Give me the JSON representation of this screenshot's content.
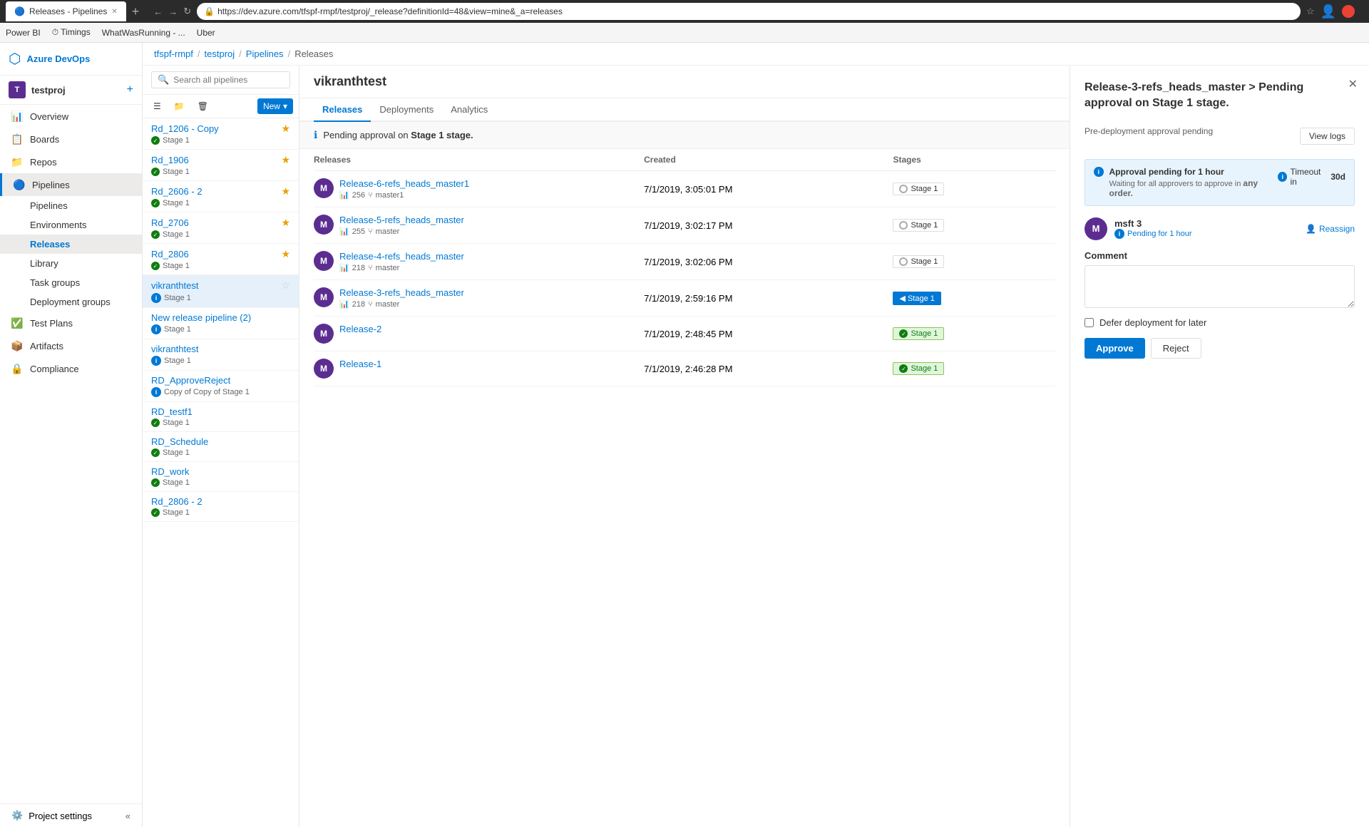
{
  "browser": {
    "tab_title": "Releases - Pipelines",
    "url": "https://dev.azure.com/tfspf-rmpf/testproj/_release?definitionId=48&view=mine&_a=releases",
    "bookmarks": [
      {
        "label": "Power BI"
      },
      {
        "label": "Timings"
      },
      {
        "label": "WhatWasRunning - ..."
      },
      {
        "label": "Uber"
      }
    ]
  },
  "sidebar": {
    "logo_label": "Azure DevOps",
    "project_name": "testproj",
    "project_initials": "T",
    "nav_items": [
      {
        "id": "overview",
        "label": "Overview",
        "icon": "📊"
      },
      {
        "id": "boards",
        "label": "Boards",
        "icon": "📋"
      },
      {
        "id": "repos",
        "label": "Repos",
        "icon": "📁"
      },
      {
        "id": "pipelines",
        "label": "Pipelines",
        "icon": "🔵"
      },
      {
        "id": "test-plans",
        "label": "Test Plans",
        "icon": "✅"
      },
      {
        "id": "artifacts",
        "label": "Artifacts",
        "icon": "📦"
      },
      {
        "id": "compliance",
        "label": "Compliance",
        "icon": "🔒"
      }
    ],
    "sub_nav": [
      {
        "id": "pipelines-sub",
        "label": "Pipelines"
      },
      {
        "id": "environments-sub",
        "label": "Environments"
      },
      {
        "id": "releases-sub",
        "label": "Releases"
      },
      {
        "id": "library-sub",
        "label": "Library"
      },
      {
        "id": "task-groups-sub",
        "label": "Task groups"
      },
      {
        "id": "deployment-groups-sub",
        "label": "Deployment groups"
      }
    ],
    "settings_label": "Project settings"
  },
  "breadcrumb": {
    "org": "tfspf-rmpf",
    "project": "testproj",
    "section": "Pipelines",
    "page": "Releases"
  },
  "pipeline_list": {
    "search_placeholder": "Search all pipelines",
    "new_button": "New",
    "items": [
      {
        "name": "Rd_1206 - Copy",
        "stage": "Stage 1",
        "stage_type": "green",
        "starred": true
      },
      {
        "name": "Rd_1906",
        "stage": "Stage 1",
        "stage_type": "green",
        "starred": true
      },
      {
        "name": "Rd_2606 - 2",
        "stage": "Stage 1",
        "stage_type": "green",
        "starred": true
      },
      {
        "name": "Rd_2706",
        "stage": "Stage 1",
        "stage_type": "green",
        "starred": true
      },
      {
        "name": "Rd_2806",
        "stage": "Stage 1",
        "stage_type": "green",
        "starred": true
      },
      {
        "name": "vikranthtest",
        "stage": "Stage 1",
        "stage_type": "blue",
        "starred": false,
        "active": true
      },
      {
        "name": "New release pipeline (2)",
        "stage": "Stage 1",
        "stage_type": "blue",
        "starred": false
      },
      {
        "name": "vikranthtest",
        "stage": "Stage 1",
        "stage_type": "blue",
        "starred": false
      },
      {
        "name": "RD_ApproveReject",
        "stage": "Copy of Copy of Stage 1",
        "stage_type": "blue",
        "starred": false
      },
      {
        "name": "RD_testf1",
        "stage": "Stage 1",
        "stage_type": "green",
        "starred": false
      },
      {
        "name": "RD_Schedule",
        "stage": "Stage 1",
        "stage_type": "green",
        "starred": false
      },
      {
        "name": "RD_work",
        "stage": "Stage 1",
        "stage_type": "green",
        "starred": false
      },
      {
        "name": "Rd_2806 - 2",
        "stage": "Stage 1",
        "stage_type": "green",
        "starred": false
      }
    ]
  },
  "release_detail": {
    "pipeline_name": "vikranthtest",
    "tabs": [
      {
        "id": "releases",
        "label": "Releases",
        "active": true
      },
      {
        "id": "deployments",
        "label": "Deployments"
      },
      {
        "id": "analytics",
        "label": "Analytics"
      }
    ],
    "approval_banner": "Pending approval on Stage 1 stage.",
    "table_headers": [
      "Releases",
      "Created",
      "Stages"
    ],
    "releases": [
      {
        "id": "release-6",
        "name": "Release-6-refs_heads_master1",
        "avatar": "M",
        "meta_count": "256",
        "meta_branch": "master1",
        "created": "7/1/2019, 3:05:01 PM",
        "stage": "Stage 1",
        "stage_type": "outline"
      },
      {
        "id": "release-5",
        "name": "Release-5-refs_heads_master",
        "avatar": "M",
        "meta_count": "255",
        "meta_branch": "master",
        "created": "7/1/2019, 3:02:17 PM",
        "stage": "Stage 1",
        "stage_type": "outline"
      },
      {
        "id": "release-4",
        "name": "Release-4-refs_heads_master",
        "avatar": "M",
        "meta_count": "218",
        "meta_branch": "master",
        "created": "7/1/2019, 3:02:06 PM",
        "stage": "Stage 1",
        "stage_type": "outline"
      },
      {
        "id": "release-3",
        "name": "Release-3-refs_heads_master",
        "avatar": "M",
        "meta_count": "218",
        "meta_branch": "master",
        "created": "7/1/2019, 2:59:16 PM",
        "stage": "Stage 1",
        "stage_type": "active"
      },
      {
        "id": "release-2",
        "name": "Release-2",
        "avatar": "M",
        "meta_count": "",
        "meta_branch": "",
        "created": "7/1/2019, 2:48:45 PM",
        "stage": "Stage 1",
        "stage_type": "success"
      },
      {
        "id": "release-1",
        "name": "Release-1",
        "avatar": "M",
        "meta_count": "",
        "meta_branch": "",
        "created": "7/1/2019, 2:46:28 PM",
        "stage": "Stage 1",
        "stage_type": "success"
      }
    ]
  },
  "approval_panel": {
    "title": "Release-3-refs_heads_master > Pending approval on Stage 1 stage.",
    "subtitle": "Pre-deployment approval pending",
    "view_logs_label": "View logs",
    "approval_info": {
      "pending_label": "Approval pending for 1 hour",
      "waiting_text": "Waiting for all approvers to approve in",
      "any_order_text": "any order.",
      "timeout_label": "Timeout in",
      "timeout_value": "30d"
    },
    "approver": {
      "name": "msft 3",
      "initials": "M",
      "status": "Pending for 1 hour",
      "reassign_label": "Reassign"
    },
    "comment_label": "Comment",
    "comment_placeholder": "",
    "defer_label": "Defer deployment for later",
    "approve_label": "Approve",
    "reject_label": "Reject"
  }
}
